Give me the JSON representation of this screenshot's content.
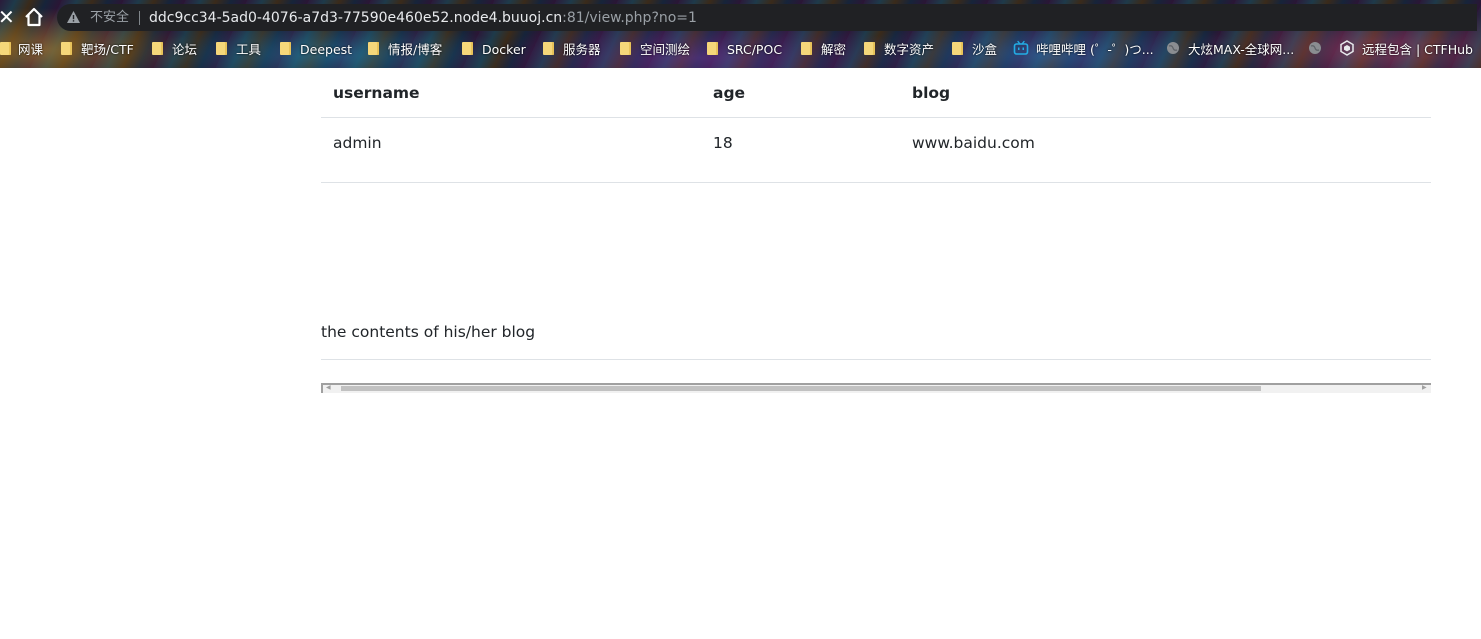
{
  "browser": {
    "security_label": "不安全",
    "url_host": "ddc9cc34-5ad0-4076-a7d3-77590e460e52.node4.buuoj.cn",
    "url_rest": ":81/view.php?no=1",
    "bookmarks": [
      {
        "label": "网课",
        "icon": "folder-icon"
      },
      {
        "label": "靶场/CTF",
        "icon": "folder-icon"
      },
      {
        "label": "论坛",
        "icon": "folder-icon"
      },
      {
        "label": "工具",
        "icon": "folder-icon"
      },
      {
        "label": "Deepest",
        "icon": "folder-icon"
      },
      {
        "label": "情报/博客",
        "icon": "folder-icon"
      },
      {
        "label": "Docker",
        "icon": "folder-icon"
      },
      {
        "label": "服务器",
        "icon": "folder-icon"
      },
      {
        "label": "空间测绘",
        "icon": "folder-icon"
      },
      {
        "label": "SRC/POC",
        "icon": "folder-icon"
      },
      {
        "label": "解密",
        "icon": "folder-icon"
      },
      {
        "label": "数字资产",
        "icon": "folder-icon"
      },
      {
        "label": "沙盒",
        "icon": "folder-icon"
      },
      {
        "label": "哔哩哔哩 (゜-゜)つ...",
        "icon": "bilibili-icon"
      },
      {
        "label": "大炫MAX-全球网...",
        "icon": "globe-icon"
      },
      {
        "label": "远程包含 | CTFHub",
        "icon": "ctfhub-icon"
      }
    ]
  },
  "table": {
    "headers": [
      "username",
      "age",
      "blog"
    ],
    "rows": [
      [
        "admin",
        "18",
        "www.baidu.com"
      ]
    ]
  },
  "contents_label": "the contents of his/her blog"
}
